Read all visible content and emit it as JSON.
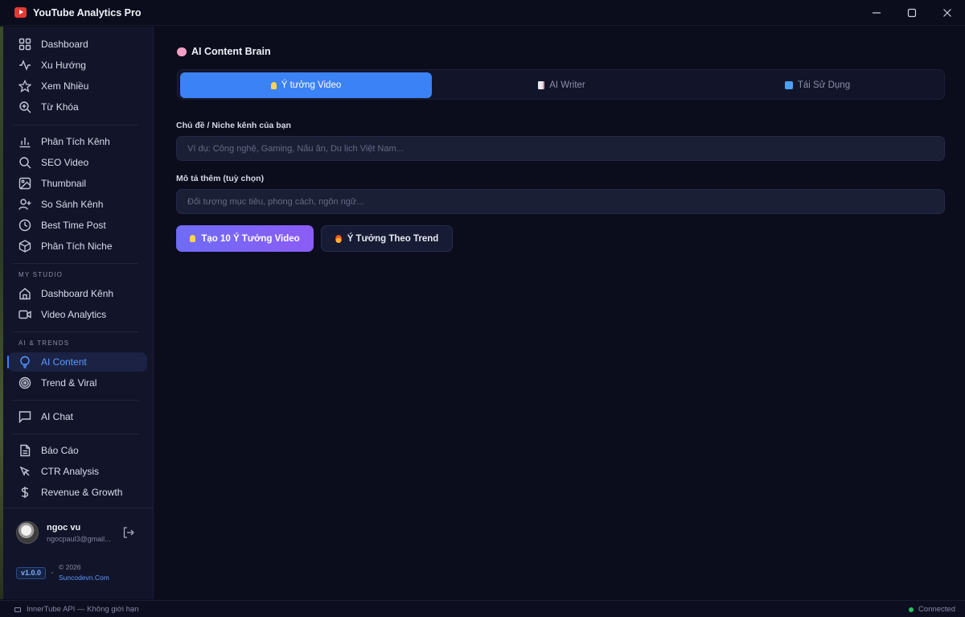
{
  "app": {
    "title": "YouTube Analytics Pro"
  },
  "sidebar": {
    "group1": [
      {
        "label": "Dashboard",
        "icon": "grid-icon"
      },
      {
        "label": "Xu Hướng",
        "icon": "activity-icon"
      },
      {
        "label": "Xem Nhiều",
        "icon": "star-icon"
      },
      {
        "label": "Từ Khóa",
        "icon": "search-plus-icon"
      }
    ],
    "group2": [
      {
        "label": "Phân Tích Kênh",
        "icon": "bar-chart-icon"
      },
      {
        "label": "SEO Video",
        "icon": "search-icon"
      },
      {
        "label": "Thumbnail",
        "icon": "image-icon"
      },
      {
        "label": "So Sánh Kênh",
        "icon": "user-plus-icon"
      },
      {
        "label": "Best Time Post",
        "icon": "clock-icon"
      },
      {
        "label": "Phân Tích Niche",
        "icon": "box-icon"
      }
    ],
    "studio_label": "MY STUDIO",
    "studio": [
      {
        "label": "Dashboard Kênh",
        "icon": "home-icon"
      },
      {
        "label": "Video Analytics",
        "icon": "video-icon"
      }
    ],
    "ai_label": "AI & TRENDS",
    "ai": [
      {
        "label": "AI Content",
        "icon": "lightbulb-icon",
        "active": true
      },
      {
        "label": "Trend & Viral",
        "icon": "target-icon"
      }
    ],
    "chat": [
      {
        "label": "AI Chat",
        "icon": "chat-icon"
      }
    ],
    "reports": [
      {
        "label": "Báo Cáo",
        "icon": "file-text-icon"
      },
      {
        "label": "CTR Analysis",
        "icon": "cursor-icon"
      },
      {
        "label": "Revenue & Growth",
        "icon": "dollar-icon"
      }
    ],
    "user": {
      "name": "ngoc vu",
      "email": "ngocpaul3@gmail..."
    },
    "version": "v1.0.0",
    "copyright": "© 2026",
    "site": "Suncodevn.Com"
  },
  "main": {
    "title": "AI Content Brain",
    "tabs": [
      {
        "label": "Ý tưởng Video"
      },
      {
        "label": "AI Writer"
      },
      {
        "label": "Tái Sử Dụng"
      }
    ],
    "topic_label": "Chủ đề / Niche kênh của bạn",
    "topic_placeholder": "Ví dụ: Công nghệ, Gaming, Nấu ăn, Du lịch Việt Nam...",
    "desc_label": "Mô tả thêm (tuỳ chọn)",
    "desc_placeholder": "Đối tượng mục tiêu, phong cách, ngôn ngữ...",
    "generate_button": "Tạo 10 Ý Tưởng Video",
    "trend_button": "Ý Tưởng Theo Trend"
  },
  "statusbar": {
    "left": "InnerTube API — Không giới hạn",
    "right": "Connected"
  },
  "colors": {
    "accent": "#3b82f6",
    "primary_button": "#7c66f7",
    "connected": "#22c55e"
  }
}
